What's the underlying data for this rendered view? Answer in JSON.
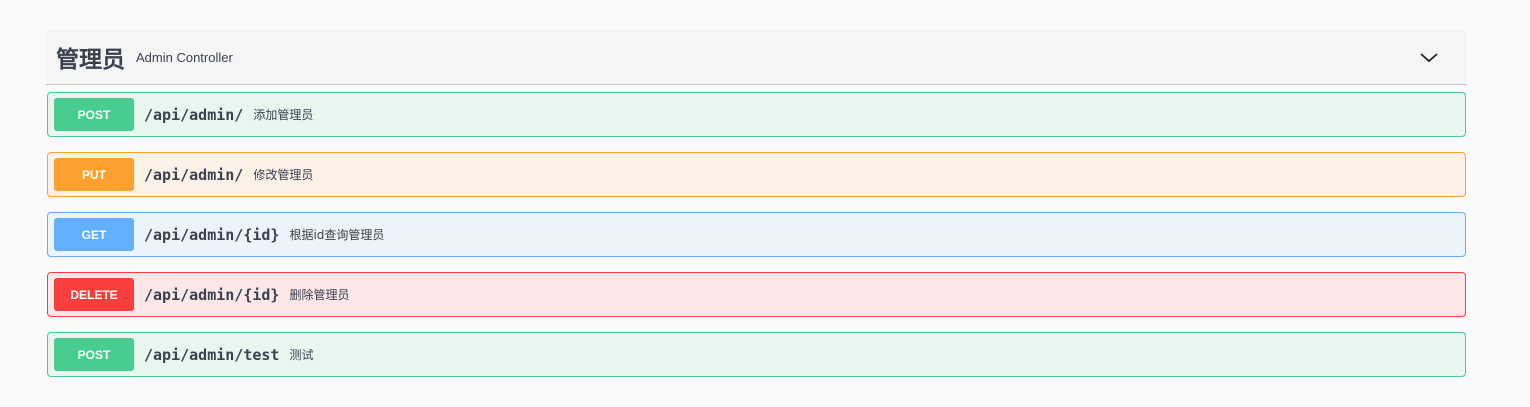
{
  "tag": {
    "name": "管理员",
    "description": "Admin Controller",
    "expanded_icon": "chevron-down-icon"
  },
  "operations": [
    {
      "method": "POST",
      "path": "/api/admin/",
      "summary": "添加管理员",
      "color": "#49cc90",
      "bg": "#e8f6f0"
    },
    {
      "method": "PUT",
      "path": "/api/admin/",
      "summary": "修改管理员",
      "color": "#fca130",
      "bg": "#fbf1e6"
    },
    {
      "method": "GET",
      "path": "/api/admin/{id}",
      "summary": "根据id查询管理员",
      "color": "#61affe",
      "bg": "#ebf3fb"
    },
    {
      "method": "DELETE",
      "path": "/api/admin/{id}",
      "summary": "删除管理员",
      "color": "#f93e3e",
      "bg": "#fbe7e7"
    },
    {
      "method": "POST",
      "path": "/api/admin/test",
      "summary": "测试",
      "color": "#49cc90",
      "bg": "#e8f6f0"
    }
  ]
}
